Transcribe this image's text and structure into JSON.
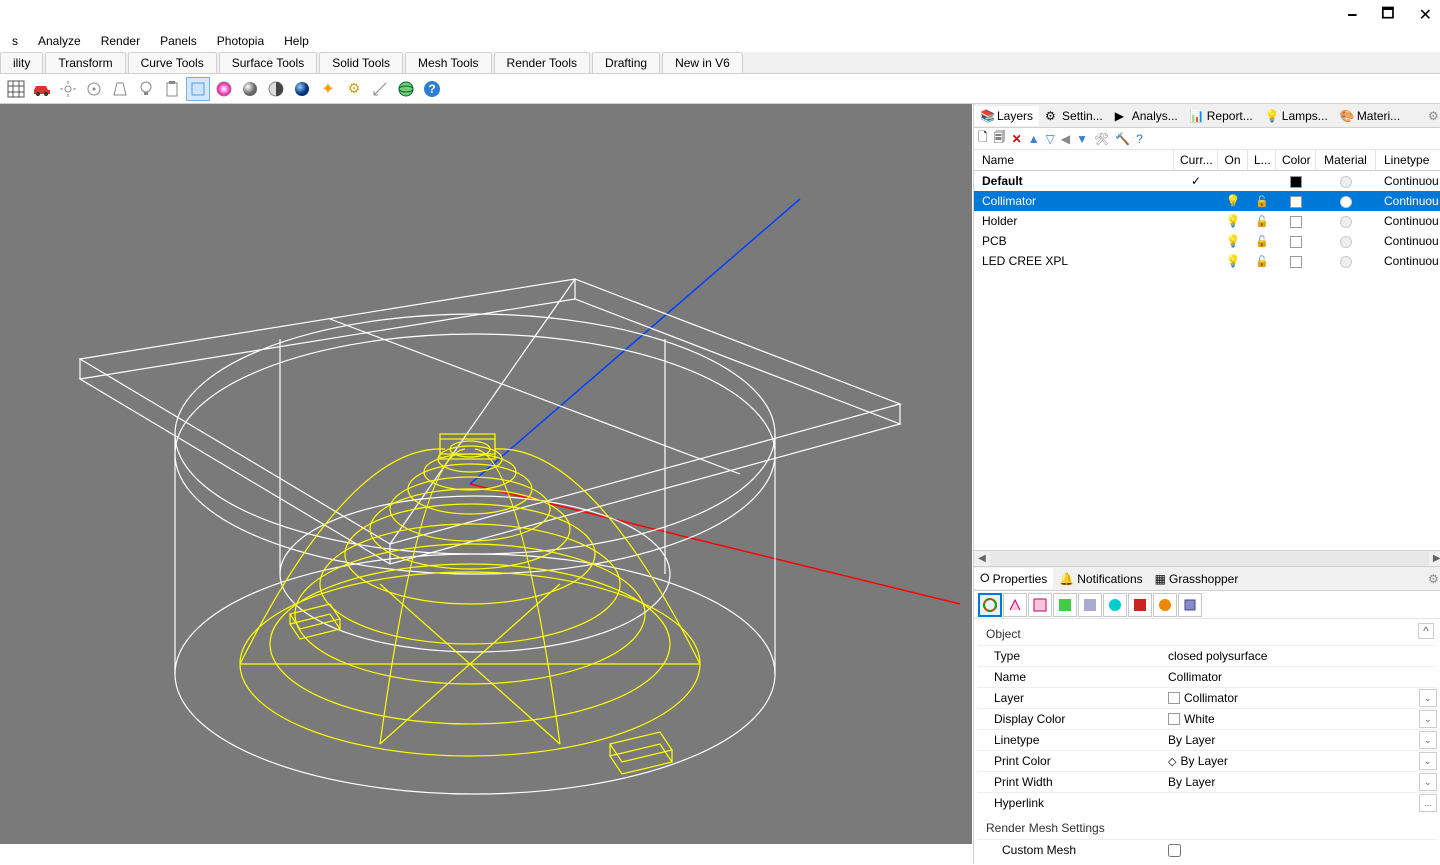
{
  "window_controls": {
    "min": "🗕",
    "max": "🗖",
    "close": "✕"
  },
  "menu": [
    "s",
    "Analyze",
    "Render",
    "Panels",
    "Photopia",
    "Help"
  ],
  "tool_tabs": [
    "ility",
    "Transform",
    "Curve Tools",
    "Surface Tools",
    "Solid Tools",
    "Mesh Tools",
    "Render Tools",
    "Drafting",
    "New in V6"
  ],
  "panel_tabs": [
    {
      "label": "Layers",
      "active": true
    },
    {
      "label": "Settin..."
    },
    {
      "label": "Analys..."
    },
    {
      "label": "Report..."
    },
    {
      "label": "Lamps..."
    },
    {
      "label": "Materi..."
    }
  ],
  "layer_columns": {
    "name": "Name",
    "curr": "Curr...",
    "on": "On",
    "lock": "L...",
    "color": "Color",
    "mat": "Material",
    "ltype": "Linetype"
  },
  "layers": [
    {
      "name": "Default",
      "bold": true,
      "current": true,
      "color": "#000000",
      "linetype": "Continuou"
    },
    {
      "name": "Collimator",
      "selected": true,
      "on": true,
      "lock": true,
      "color": "#ffffff",
      "linetype": "Continuou"
    },
    {
      "name": "Holder",
      "on": true,
      "lock": true,
      "color": "#ffffff",
      "linetype": "Continuou"
    },
    {
      "name": "PCB",
      "on": true,
      "lock": true,
      "color": "#ffffff",
      "linetype": "Continuou"
    },
    {
      "name": "LED CREE XPL",
      "on": true,
      "lock": true,
      "color": "#ffffff",
      "linetype": "Continuou"
    }
  ],
  "prop_tabs": [
    {
      "label": "Properties",
      "active": true
    },
    {
      "label": "Notifications"
    },
    {
      "label": "Grasshopper"
    }
  ],
  "props_header": "Object",
  "props": [
    {
      "k": "Type",
      "v": "closed polysurface"
    },
    {
      "k": "Name",
      "v": "Collimator"
    },
    {
      "k": "Layer",
      "v": "Collimator",
      "sw": "#ffffff",
      "dd": true
    },
    {
      "k": "Display Color",
      "v": "White",
      "sw": "#ffffff",
      "dd": true
    },
    {
      "k": "Linetype",
      "v": "By Layer",
      "dd": true
    },
    {
      "k": "Print Color",
      "v": "By Layer",
      "diamond": true,
      "dd": true
    },
    {
      "k": "Print Width",
      "v": "By Layer",
      "dd": true
    },
    {
      "k": "Hyperlink",
      "v": "",
      "dd": "..."
    }
  ],
  "render_header": "Render Mesh Settings",
  "render_rows": [
    {
      "k": "Custom Mesh",
      "cb": true
    }
  ]
}
